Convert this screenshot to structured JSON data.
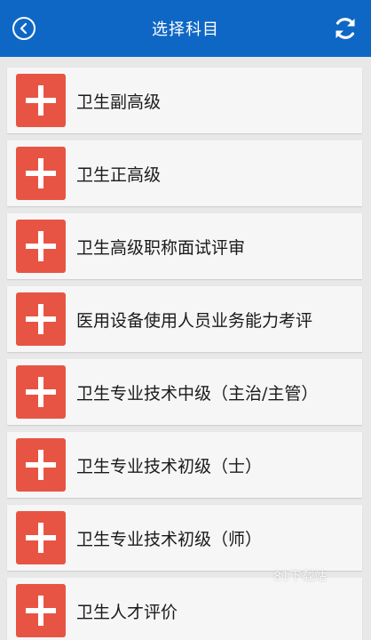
{
  "header": {
    "title": "选择科目",
    "back_icon": "back-circle-icon",
    "refresh_icon": "refresh-icon",
    "bg_color": "#0f67c5"
  },
  "subjects": [
    {
      "label": "卫生副高级"
    },
    {
      "label": "卫生正高级"
    },
    {
      "label": "卫生高级职称面试评审"
    },
    {
      "label": "医用设备使用人员业务能力考评"
    },
    {
      "label": "卫生专业技术中级（主治/主管）"
    },
    {
      "label": "卫生专业技术初级（士）"
    },
    {
      "label": "卫生专业技术初级（师）"
    },
    {
      "label": "卫生人才评价"
    }
  ],
  "add_icon": "plus-icon",
  "accent_color": "#e85444",
  "watermark": "81下载站"
}
